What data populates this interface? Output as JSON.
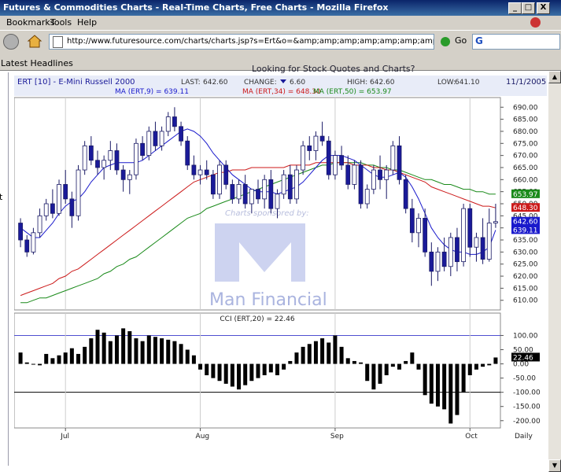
{
  "window": {
    "title": "Futures & Commodities Charts - Real-Time Charts, Free Charts - Mozilla Firefox",
    "controls": [
      "_",
      "□",
      "X"
    ]
  },
  "menu": {
    "items": [
      "Bookmarks",
      "Tools",
      "Help"
    ]
  },
  "nav": {
    "url": "http://www.futuresource.com/charts/charts.jsp?s=Ert&o=&amp;amp;amp;amp;amp;amp;amp;amp;amp;a=D8",
    "go_label": "Go",
    "search_icon_letter": "G"
  },
  "bookmarks": {
    "first": "Latest Headlines"
  },
  "page": {
    "cut_text": "Looking for Stock Quotes and Charts?",
    "left_stub": "t"
  },
  "chart_data": {
    "type": "line",
    "header": {
      "symbol": "ERT [10] - E-Mini Russell 2000",
      "last_label": "LAST:",
      "last": "642.60",
      "change_label": "CHANGE:",
      "change": "6.60",
      "high_label": "HIGH:",
      "high": "642.60",
      "low_label": "LOW:",
      "low": "641.10",
      "date": "11/1/2005"
    },
    "ma_legend": [
      {
        "text": "MA (ERT,9) = 639.11",
        "color": "#1a1acc"
      },
      {
        "text": "MA (ERT,34) = 648.30",
        "color": "#cc1a1a"
      },
      {
        "text": "MA (ERT,50) = 653.97",
        "color": "#1a8a1a"
      }
    ],
    "price_axis": {
      "min": 610,
      "max": 690,
      "ticks": [
        "690.00",
        "685.00",
        "680.00",
        "675.00",
        "670.00",
        "665.00",
        "660.00",
        "655.00",
        "650.00",
        "645.00",
        "640.00",
        "635.00",
        "630.00",
        "625.00",
        "620.00",
        "615.00",
        "610.00"
      ]
    },
    "price_tags": [
      {
        "text": "653.97",
        "value": 653.97,
        "color": "#1a8a1a"
      },
      {
        "text": "648.30",
        "value": 648.3,
        "color": "#cc1a1a"
      },
      {
        "text": "642.60",
        "value": 642.6,
        "color": "#1a1acc"
      },
      {
        "text": "639.11",
        "value": 639.11,
        "color": "#1a1acc"
      }
    ],
    "candles": [
      [
        642,
        644,
        632,
        635
      ],
      [
        635,
        637,
        628,
        630
      ],
      [
        630,
        640,
        629,
        638
      ],
      [
        638,
        648,
        636,
        645
      ],
      [
        645,
        652,
        643,
        650
      ],
      [
        650,
        656,
        644,
        646
      ],
      [
        646,
        660,
        645,
        658
      ],
      [
        658,
        664,
        650,
        652
      ],
      [
        652,
        655,
        640,
        645
      ],
      [
        645,
        666,
        643,
        664
      ],
      [
        664,
        676,
        662,
        674
      ],
      [
        674,
        678,
        666,
        668
      ],
      [
        668,
        672,
        662,
        665
      ],
      [
        665,
        670,
        660,
        668
      ],
      [
        668,
        676,
        664,
        672
      ],
      [
        672,
        675,
        662,
        664
      ],
      [
        664,
        666,
        655,
        660
      ],
      [
        660,
        664,
        654,
        662
      ],
      [
        662,
        677,
        660,
        675
      ],
      [
        675,
        678,
        668,
        670
      ],
      [
        670,
        682,
        668,
        680
      ],
      [
        680,
        684,
        672,
        674
      ],
      [
        674,
        682,
        672,
        680
      ],
      [
        680,
        688,
        678,
        686
      ],
      [
        686,
        690,
        680,
        682
      ],
      [
        682,
        684,
        674,
        676
      ],
      [
        676,
        678,
        664,
        666
      ],
      [
        666,
        670,
        660,
        662
      ],
      [
        662,
        666,
        658,
        664
      ],
      [
        664,
        668,
        660,
        662
      ],
      [
        662,
        664,
        652,
        654
      ],
      [
        654,
        668,
        652,
        666
      ],
      [
        666,
        668,
        656,
        658
      ],
      [
        658,
        660,
        650,
        652
      ],
      [
        652,
        660,
        650,
        658
      ],
      [
        658,
        662,
        648,
        650
      ],
      [
        650,
        652,
        646,
        656
      ],
      [
        656,
        660,
        650,
        652
      ],
      [
        652,
        662,
        648,
        660
      ],
      [
        660,
        664,
        646,
        648
      ],
      [
        648,
        656,
        644,
        654
      ],
      [
        654,
        664,
        652,
        662
      ],
      [
        662,
        666,
        650,
        652
      ],
      [
        652,
        666,
        650,
        664
      ],
      [
        664,
        676,
        662,
        674
      ],
      [
        674,
        678,
        668,
        672
      ],
      [
        672,
        680,
        668,
        678
      ],
      [
        678,
        684,
        674,
        676
      ],
      [
        676,
        678,
        660,
        662
      ],
      [
        662,
        672,
        660,
        670
      ],
      [
        670,
        674,
        664,
        666
      ],
      [
        666,
        670,
        656,
        658
      ],
      [
        658,
        668,
        656,
        666
      ],
      [
        666,
        668,
        648,
        650
      ],
      [
        650,
        658,
        648,
        656
      ],
      [
        656,
        666,
        654,
        664
      ],
      [
        664,
        670,
        656,
        660
      ],
      [
        660,
        666,
        652,
        664
      ],
      [
        664,
        676,
        662,
        674
      ],
      [
        674,
        678,
        658,
        660
      ],
      [
        660,
        662,
        646,
        648
      ],
      [
        648,
        652,
        634,
        638
      ],
      [
        638,
        646,
        632,
        644
      ],
      [
        644,
        648,
        628,
        630
      ],
      [
        630,
        634,
        616,
        622
      ],
      [
        622,
        632,
        618,
        630
      ],
      [
        630,
        636,
        622,
        624
      ],
      [
        624,
        638,
        620,
        636
      ],
      [
        636,
        640,
        622,
        626
      ],
      [
        626,
        650,
        624,
        648
      ],
      [
        648,
        650,
        628,
        632
      ],
      [
        632,
        638,
        626,
        636
      ],
      [
        636,
        644,
        625,
        627
      ],
      [
        627,
        648,
        626,
        642
      ],
      [
        642,
        650,
        640,
        642.6
      ]
    ],
    "ma9_series": [
      640,
      638,
      636,
      636,
      639,
      642,
      646,
      649,
      651,
      652,
      655,
      659,
      662,
      665,
      666,
      667,
      667,
      667,
      667,
      668,
      670,
      672,
      674,
      676,
      678,
      680,
      681,
      680,
      678,
      675,
      671,
      668,
      665,
      662,
      660,
      658,
      656,
      655,
      655,
      655,
      654,
      655,
      656,
      657,
      659,
      662,
      665,
      668,
      670,
      670,
      670,
      669,
      668,
      666,
      664,
      662,
      661,
      661,
      662,
      663,
      661,
      657,
      652,
      646,
      640,
      636,
      633,
      631,
      630,
      630,
      629,
      629,
      630,
      632,
      639.11
    ],
    "ma34_series": [
      612,
      613,
      614,
      615,
      616,
      617,
      619,
      620,
      622,
      623,
      625,
      627,
      629,
      631,
      633,
      635,
      637,
      639,
      641,
      643,
      645,
      647,
      649,
      651,
      653,
      655,
      657,
      659,
      660,
      661,
      662,
      663,
      663,
      664,
      664,
      664,
      665,
      665,
      665,
      665,
      665,
      665,
      666,
      666,
      666,
      666,
      667,
      667,
      667,
      667,
      667,
      667,
      666,
      666,
      666,
      665,
      665,
      664,
      664,
      663,
      662,
      661,
      660,
      659,
      657,
      656,
      655,
      654,
      653,
      652,
      651,
      650,
      649,
      649,
      648.3
    ],
    "ma50_series": [
      609,
      609,
      610,
      611,
      611,
      612,
      613,
      614,
      615,
      616,
      617,
      618,
      619,
      621,
      622,
      624,
      625,
      627,
      628,
      630,
      632,
      634,
      636,
      638,
      640,
      642,
      644,
      645,
      646,
      648,
      649,
      650,
      651,
      652,
      653,
      654,
      655,
      656,
      657,
      658,
      659,
      660,
      661,
      662,
      663,
      664,
      665,
      666,
      666,
      667,
      667,
      667,
      667,
      667,
      666,
      666,
      665,
      665,
      664,
      664,
      663,
      662,
      661,
      660,
      660,
      659,
      658,
      658,
      657,
      656,
      656,
      655,
      655,
      654,
      653.97
    ],
    "cci": {
      "title": "CCI (ERT,20) = 22.46",
      "min": -220,
      "max": 140,
      "ticks": [
        "100.00",
        "50.00",
        "0.00",
        "-50.00",
        "-100.00",
        "-150.00",
        "-200.00"
      ],
      "ref_lines": [
        100,
        -100
      ],
      "last_tag": "22.46",
      "values": [
        40,
        5,
        0,
        -5,
        35,
        20,
        30,
        40,
        55,
        35,
        60,
        90,
        120,
        110,
        80,
        100,
        125,
        115,
        90,
        80,
        100,
        95,
        90,
        85,
        80,
        70,
        50,
        30,
        -20,
        -40,
        -50,
        -60,
        -70,
        -80,
        -90,
        -75,
        -60,
        -50,
        -40,
        -30,
        -40,
        -20,
        10,
        40,
        60,
        70,
        80,
        90,
        75,
        100,
        60,
        20,
        10,
        5,
        -60,
        -90,
        -70,
        -40,
        -10,
        -20,
        10,
        40,
        -20,
        -110,
        -140,
        -150,
        -160,
        -210,
        -180,
        -100,
        -40,
        -20,
        -10,
        -5,
        22.46
      ]
    },
    "x_labels": [
      {
        "text": "Jul",
        "index": 7
      },
      {
        "text": "Aug",
        "index": 28
      },
      {
        "text": "Sep",
        "index": 49
      },
      {
        "text": "Oct",
        "index": 70
      }
    ],
    "x_axis_right": "Daily",
    "watermark": {
      "sponsored": "Charts sponsored by:",
      "brand": "Man Financial"
    },
    "colors": {
      "up": "#ffffff",
      "down": "#1a1a99",
      "edge": "#1a1a66",
      "bg": "#ffffff",
      "header": "#1a1a99"
    }
  }
}
